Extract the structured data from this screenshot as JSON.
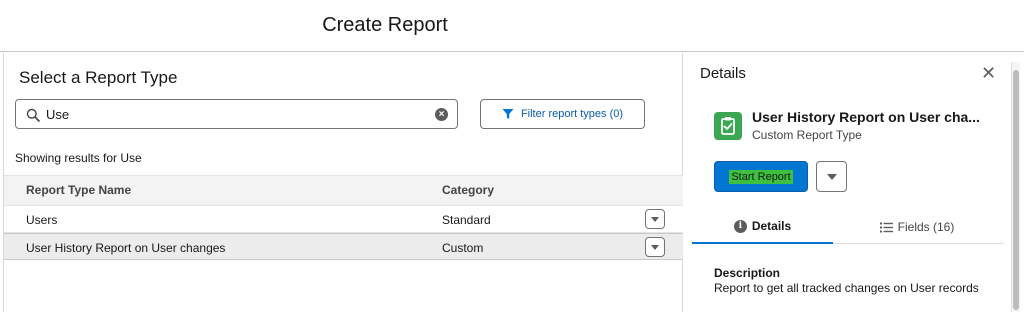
{
  "modal": {
    "title": "Create Report"
  },
  "left": {
    "title": "Select a Report Type",
    "search": {
      "value": "Use",
      "placeholder": ""
    },
    "filter_label": "Filter report types (0)",
    "showing": "Showing results for Use",
    "columns": {
      "name": "Report Type Name",
      "category": "Category"
    },
    "rows": [
      {
        "name": "Users",
        "category": "Standard"
      },
      {
        "name": "User History Report on User changes",
        "category": "Custom"
      }
    ]
  },
  "details": {
    "title": "Details",
    "close_icon": "close-icon",
    "report_name": "User History Report on User cha...",
    "report_type": "Custom Report Type",
    "start_label": "Start Report",
    "tabs": [
      {
        "label": "Details",
        "icon": "info-icon"
      },
      {
        "label": "Fields (16)",
        "icon": "list-icon"
      }
    ],
    "description_heading": "Description",
    "description": "Report to get all tracked changes on User records"
  },
  "colors": {
    "brand": "#0176d3",
    "link": "#0b5cab",
    "report_icon": "#3ba755"
  }
}
